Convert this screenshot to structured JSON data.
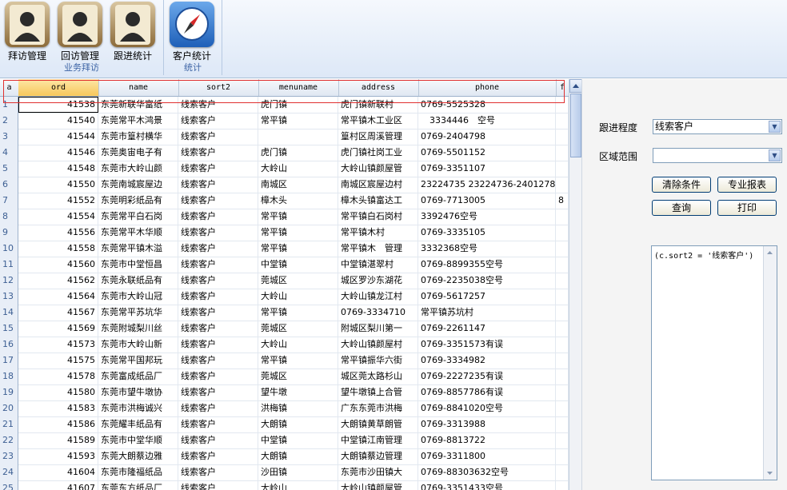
{
  "ribbon": {
    "groups": [
      {
        "title": "业务拜访",
        "buttons": [
          {
            "label": "拜访管理",
            "icon": "user-book-icon"
          },
          {
            "label": "回访管理",
            "icon": "user-book-icon"
          },
          {
            "label": "跟进统计",
            "icon": "user-book-icon"
          }
        ]
      },
      {
        "title": "统计",
        "buttons": [
          {
            "label": "客户统计",
            "icon": "compass-icon"
          }
        ]
      }
    ]
  },
  "grid": {
    "corner": "a",
    "columns": [
      "ord",
      "name",
      "sort2",
      "menuname",
      "address",
      "phone",
      "f"
    ],
    "rows": [
      [
        "1",
        "41538",
        "东莞新联华富纸",
        "线索客户",
        "虎门镇",
        "虎门镇新联村",
        "0769-5525328",
        ""
      ],
      [
        "2",
        "41540",
        "东莞常平木鸿景",
        "线索客户",
        "常平镇",
        "常平镇木工业区",
        "　3334446　空号",
        ""
      ],
      [
        "3",
        "41544",
        "东莞市篁村横华",
        "线索客户",
        "",
        "篁村区周溪管理",
        "0769-2404798",
        ""
      ],
      [
        "4",
        "41546",
        "东莞奥宙电子有",
        "线索客户",
        "虎门镇",
        "虎门镇社岗工业",
        "0769-5501152",
        ""
      ],
      [
        "5",
        "41548",
        "东莞市大岭山颜",
        "线索客户",
        "大岭山",
        "大岭山镇颜屋管",
        "0769-3351107",
        ""
      ],
      [
        "6",
        "41550",
        "东莞南城宸屋边",
        "线索客户",
        "南城区",
        "南城区宸屋边村",
        "23224735 23224736-2401278",
        ""
      ],
      [
        "7",
        "41552",
        "东莞明彩纸品有",
        "线索客户",
        "樟木头",
        "樟木头镇富达工",
        "0769-7713005",
        "8"
      ],
      [
        "8",
        "41554",
        "东莞常平白石岗",
        "线索客户",
        "常平镇",
        "常平镇白石岗村",
        "3392476空号",
        ""
      ],
      [
        "9",
        "41556",
        "东莞常平木华顺",
        "线索客户",
        "常平镇",
        "常平镇木村",
        "0769-3335105",
        ""
      ],
      [
        "10",
        "41558",
        "东莞常平镇木溢",
        "线索客户",
        "常平镇",
        "常平镇木　管理",
        "3332368空号",
        ""
      ],
      [
        "11",
        "41560",
        "东莞市中堂恒昌",
        "线索客户",
        "中堂镇",
        "中堂镇湛翠村",
        "0769-8899355空号",
        ""
      ],
      [
        "12",
        "41562",
        "东莞永联纸品有",
        "线索客户",
        "莞城区",
        "城区罗沙东湖花",
        "0769-2235038空号",
        ""
      ],
      [
        "13",
        "41564",
        "东莞市大岭山冠",
        "线索客户",
        "大岭山",
        "大岭山镇龙江村",
        "0769-5617257",
        ""
      ],
      [
        "14",
        "41567",
        "东莞常平苏坑华",
        "线索客户",
        "常平镇",
        "0769-3334710",
        "常平镇苏坑村",
        ""
      ],
      [
        "15",
        "41569",
        "东莞附城梨川丝",
        "线索客户",
        "莞城区",
        "附城区梨川第一",
        "0769-2261147",
        ""
      ],
      [
        "16",
        "41573",
        "东莞市大岭山新",
        "线索客户",
        "大岭山",
        "大岭山镇颜屋村",
        "0769-3351573有误",
        ""
      ],
      [
        "17",
        "41575",
        "东莞常平国邦玩",
        "线索客户",
        "常平镇",
        "常平镇振华六街",
        "0769-3334982",
        ""
      ],
      [
        "18",
        "41578",
        "东莞富成纸品厂",
        "线索客户",
        "莞城区",
        "城区莞太路杉山",
        "0769-2227235有误",
        ""
      ],
      [
        "19",
        "41580",
        "东莞市望牛墩协",
        "线索客户",
        "望牛墩",
        "望牛墩镇上合管",
        "0769-8857786有误",
        ""
      ],
      [
        "20",
        "41583",
        "东莞市洪梅诚兴",
        "线索客户",
        "洪梅镇",
        "广东东莞市洪梅",
        "0769-8841020空号",
        ""
      ],
      [
        "21",
        "41586",
        "东莞耀丰纸品有",
        "线索客户",
        "大朗镇",
        "大朗镇黄草朗管",
        "0769-3313988",
        ""
      ],
      [
        "22",
        "41589",
        "东莞市中堂华顺",
        "线索客户",
        "中堂镇",
        "中堂镇江南管理",
        "0769-8813722",
        ""
      ],
      [
        "23",
        "41593",
        "东莞大朗蔡边雅",
        "线索客户",
        "大朗镇",
        "大朗镇蔡边管理",
        "0769-3311800",
        ""
      ],
      [
        "24",
        "41604",
        "东莞市隆福纸品",
        "线索客户",
        "沙田镇",
        "东莞市沙田镇大",
        "0769-88303632空号",
        ""
      ],
      [
        "25",
        "41607",
        "东莞东方纸品厂",
        "线索客户",
        "大岭山",
        "大岭山镇颜屋管",
        "0769-3351433空号",
        ""
      ]
    ]
  },
  "panel": {
    "progress_label": "跟进程度",
    "progress_value": "线索客户",
    "region_label": "区域范围",
    "region_value": "",
    "buttons": {
      "clear": "清除条件",
      "report": "专业报表",
      "query": "查询",
      "print": "打印"
    },
    "condition_text": "(c.sort2 = '线索客户')"
  }
}
